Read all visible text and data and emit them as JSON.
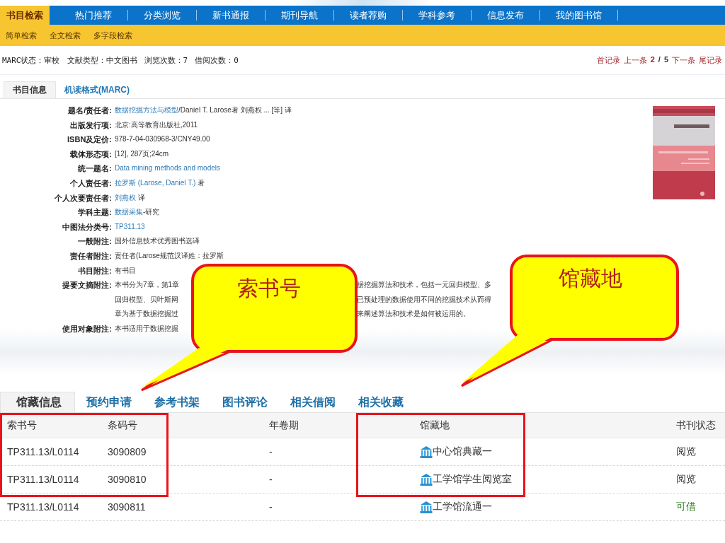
{
  "nav": {
    "items": [
      {
        "label": "书目检索",
        "selected": true
      },
      {
        "label": "热门推荐",
        "selected": false
      },
      {
        "label": "分类浏览",
        "selected": false
      },
      {
        "label": "新书通报",
        "selected": false
      },
      {
        "label": "期刊导航",
        "selected": false
      },
      {
        "label": "读者荐购",
        "selected": false
      },
      {
        "label": "学科参考",
        "selected": false
      },
      {
        "label": "信息发布",
        "selected": false
      },
      {
        "label": "我的图书馆",
        "selected": false
      }
    ],
    "sub_items": [
      "简单检索",
      "全文检索",
      "多字段检索"
    ]
  },
  "record_info": [
    "MARC状态：审校",
    "文献类型：中文图书",
    "浏览次数：7",
    "借阅次数：0"
  ],
  "pager": {
    "first": "首记录",
    "prev": "上一条",
    "current": "2",
    "separator": "/",
    "total": "5",
    "next": "下一条",
    "last": "尾记录"
  },
  "detail_tabs": [
    {
      "label": "书目信息",
      "selected": true
    },
    {
      "label": "机读格式(MARC)",
      "selected": false
    }
  ],
  "fields": [
    {
      "kind": "text",
      "label": "题名/责任者:",
      "value": [
        {
          "text": "数据挖掘方法与模型",
          "link": true
        },
        {
          "text": "/Daniel T. Larose著 刘燕权 ... [等] 译",
          "link": false
        }
      ]
    },
    {
      "kind": "text",
      "label": "出版发行项:",
      "value": [
        {
          "text": "北京:高等教育出版社,2011",
          "link": false
        }
      ]
    },
    {
      "kind": "text",
      "label": "ISBN及定价:",
      "value": [
        {
          "text": "978-7-04-030968-3/CNY49.00",
          "link": false
        }
      ]
    },
    {
      "kind": "text",
      "label": "载体形态项:",
      "value": [
        {
          "text": "[12], 287页;24cm",
          "link": false
        }
      ]
    },
    {
      "kind": "text",
      "label": "统一题名:",
      "value": [
        {
          "text": "Data mining methods and models",
          "link": true
        }
      ]
    },
    {
      "kind": "text",
      "label": "个人责任者:",
      "value": [
        {
          "text": "拉罗斯 (Larose, Daniel T.)",
          "link": true
        },
        {
          "text": " 著",
          "link": false
        }
      ]
    },
    {
      "kind": "text",
      "label": "个人次要责任者:",
      "value": [
        {
          "text": "刘燕权",
          "link": true
        },
        {
          "text": " 译",
          "link": false
        }
      ]
    },
    {
      "kind": "text",
      "label": "学科主题:",
      "value": [
        {
          "text": "数据采集",
          "link": true
        },
        {
          "text": "-研究",
          "link": false
        }
      ]
    },
    {
      "kind": "text",
      "label": "中图法分类号:",
      "value": [
        {
          "text": "TP311.13",
          "link": true
        }
      ]
    },
    {
      "kind": "text",
      "label": "一般附注:",
      "value": [
        {
          "text": "国外信息技术优秀图书选译",
          "link": false
        }
      ]
    },
    {
      "kind": "text",
      "label": "责任者附注:",
      "value": [
        {
          "text": "责任者(Larose规范汉译姓：拉罗斯",
          "link": false
        }
      ]
    },
    {
      "kind": "text",
      "label": "书目附注:",
      "value": [
        {
          "text": "有书目",
          "link": false
        }
      ]
    },
    {
      "kind": "fragments",
      "label": "提要文摘附注:",
      "lines": [
        [
          "本书分为7章，第1章",
          "据挖掘算法和技术，包括一元回归模型、多"
        ],
        [
          "回归模型、贝叶斯网",
          "已预处理的数据使用不同的挖掘技术从而得"
        ],
        [
          "章为基于数据挖掘过",
          "来阐述算法和技术是如何被运用的。"
        ]
      ]
    },
    {
      "kind": "fragments",
      "label": "使用对象附注:",
      "lines": [
        [
          "本书适用于数据挖掘"
        ]
      ]
    }
  ],
  "holdings_tabs": [
    {
      "label": "馆藏信息",
      "selected": true
    },
    {
      "label": "预约申请",
      "selected": false
    },
    {
      "label": "参考书架",
      "selected": false
    },
    {
      "label": "图书评论",
      "selected": false
    },
    {
      "label": "相关借阅",
      "selected": false
    },
    {
      "label": "相关收藏",
      "selected": false
    }
  ],
  "table": {
    "columns": [
      "索书号",
      "条码号",
      "年卷期",
      "馆藏地",
      "书刊状态"
    ],
    "rows": [
      {
        "call_number": "TP311.13/L0114",
        "barcode": "3090809",
        "volume": "-",
        "location": "中心馆典藏一",
        "status": "阅览",
        "color": "#333333"
      },
      {
        "call_number": "TP311.13/L0114",
        "barcode": "3090810",
        "volume": "-",
        "location": "工学馆学生阅览室",
        "status": "阅览",
        "color": "#333333"
      },
      {
        "call_number": "TP311.13/L0114",
        "barcode": "3090811",
        "volume": "-",
        "location": "工学馆流通一",
        "status": "可借",
        "color": "#2e7d1f"
      }
    ]
  },
  "callouts": [
    {
      "text": "索书号"
    },
    {
      "text": "馆藏地"
    }
  ]
}
